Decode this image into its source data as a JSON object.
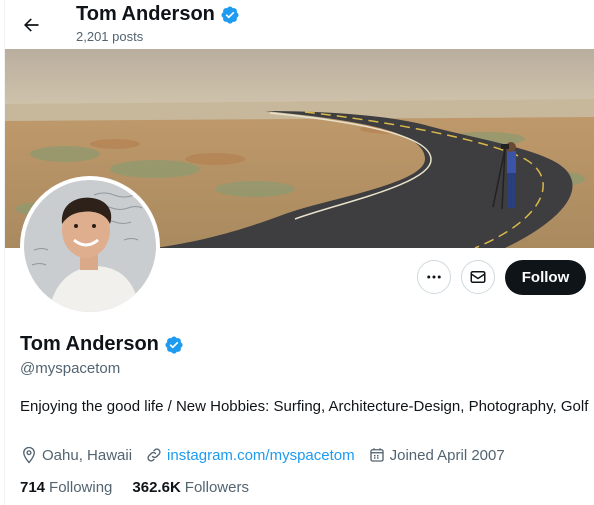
{
  "header": {
    "name": "Tom Anderson",
    "posts_count": "2,201 posts"
  },
  "profile": {
    "display_name": "Tom Anderson",
    "handle": "@myspacetom",
    "bio": "Enjoying the good life / New Hobbies: Surfing, Architecture-Design, Photography, Golf",
    "location": "Oahu, Hawaii",
    "website": "instagram.com/myspacetom",
    "joined": "Joined April 2007",
    "following_count": "714",
    "following_label": "Following",
    "followers_count": "362.6K",
    "followers_label": "Followers"
  },
  "actions": {
    "follow_label": "Follow"
  },
  "icons": {
    "back": "arrow-left-icon",
    "verified": "verified-badge-icon",
    "more": "more-dots-icon",
    "message": "mail-icon",
    "location": "map-pin-icon",
    "link": "link-icon",
    "calendar": "calendar-icon"
  },
  "colors": {
    "accent": "#1d9bf0",
    "text": "#0f1419",
    "secondary": "#536471",
    "follow_bg": "#0f1419"
  }
}
